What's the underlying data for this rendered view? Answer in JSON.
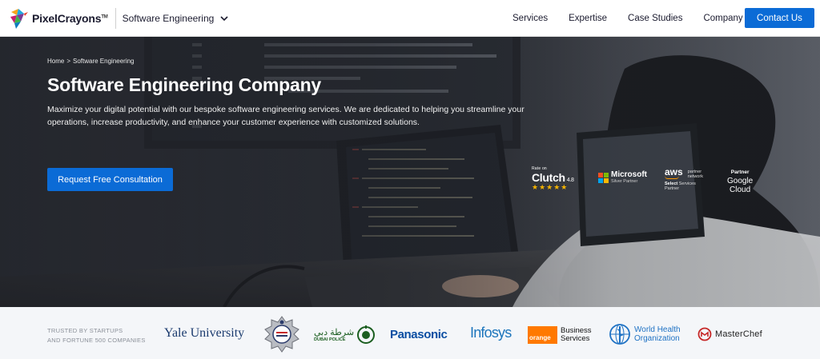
{
  "header": {
    "brand": "PixelCrayons",
    "brand_tm": "TM",
    "section": "Software Engineering",
    "nav": [
      "Services",
      "Expertise",
      "Case Studies",
      "Company"
    ],
    "contact_label": "Contact Us"
  },
  "hero": {
    "breadcrumb": [
      "Home",
      "Software Engineering"
    ],
    "breadcrumb_sep": ">",
    "title": "Software Engineering Company",
    "description": "Maximize your digital potential with our bespoke software engineering services. We are dedicated to helping you streamline your operations, increase productivity, and enhance your customer experience with customized solutions.",
    "cta_label": "Request Free Consultation",
    "badges": {
      "clutch": {
        "rated": "Rate on",
        "name": "Clutch",
        "score": "4.8",
        "stars": "★★★★★"
      },
      "microsoft": {
        "name": "Microsoft",
        "tier": "Silver Partner"
      },
      "aws": {
        "name": "aws",
        "partner": "partner",
        "network": "network",
        "select": "Select",
        "tier": "Services Partner"
      },
      "google": {
        "label": "Partner",
        "name": "Google Cloud"
      }
    }
  },
  "trusted": {
    "label_line1": "TRUSTED BY STARTUPS",
    "label_line2": "AND FORTUNE 500 COMPANIES",
    "clients": {
      "yale": "Yale University",
      "dubai_police_ar": "شرطة دبي",
      "dubai_police_en": "DUBAI POLICE",
      "panasonic": "Panasonic",
      "infosys": "Infosys",
      "orange": "orange",
      "orange_bs1": "Business",
      "orange_bs2": "Services",
      "who1": "World Health",
      "who2": "Organization",
      "masterchef": "MasterChef"
    }
  },
  "colors": {
    "accent": "#0b6bd6",
    "clutch_star": "#f5b301",
    "orange": "#ff7900",
    "who_blue": "#1f72c4"
  },
  "icons": [
    "logo-bird-icon",
    "chevron-down-icon",
    "microsoft-grid-icon",
    "police-badge-icon",
    "dubai-police-emblem-icon",
    "who-emblem-icon",
    "masterchef-icon"
  ]
}
